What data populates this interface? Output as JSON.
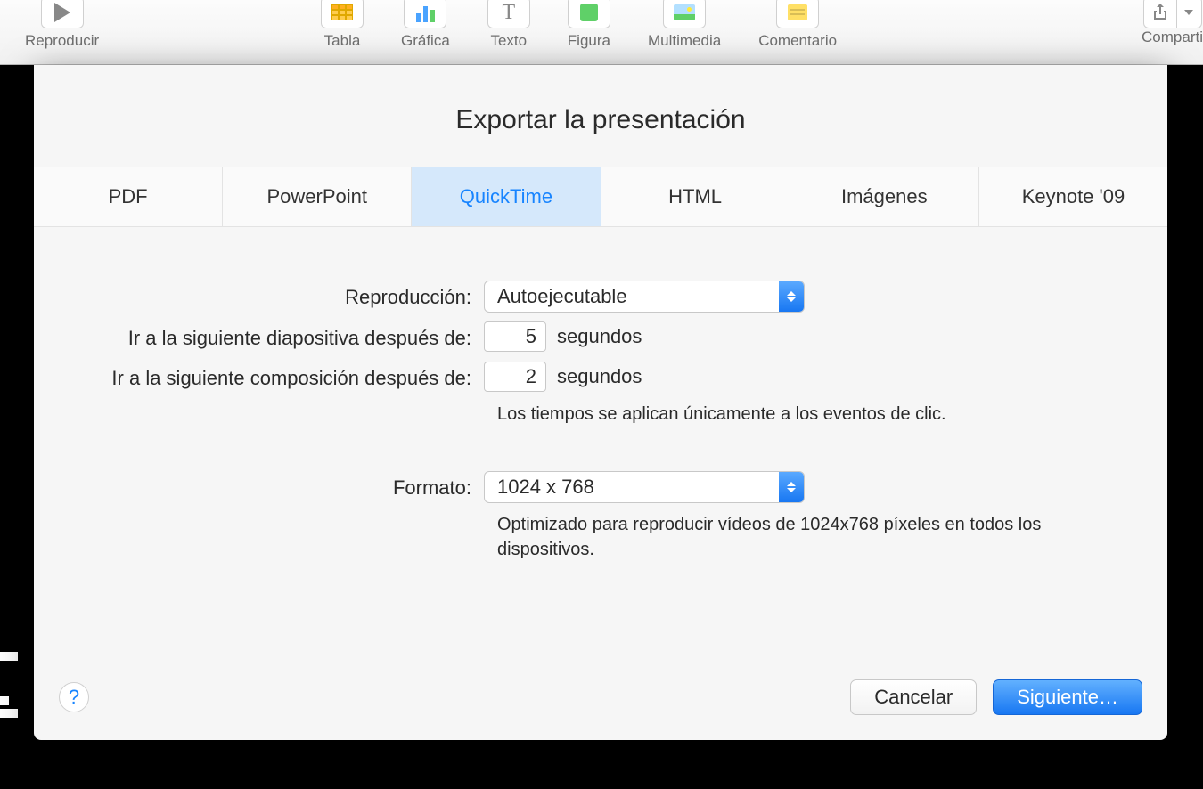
{
  "toolbar": {
    "play_label": "Reproducir",
    "items": [
      {
        "label": "Tabla"
      },
      {
        "label": "Gráfica"
      },
      {
        "label": "Texto"
      },
      {
        "label": "Figura"
      },
      {
        "label": "Multimedia"
      },
      {
        "label": "Comentario"
      }
    ],
    "share_label": "Comparti"
  },
  "dialog": {
    "title": "Exportar la presentación",
    "tabs": [
      {
        "label": "PDF"
      },
      {
        "label": "PowerPoint"
      },
      {
        "label": "QuickTime"
      },
      {
        "label": "HTML"
      },
      {
        "label": "Imágenes"
      },
      {
        "label": "Keynote '09"
      }
    ],
    "playback_label": "Reproducción:",
    "playback_value": "Autoejecutable",
    "next_slide_label": "Ir a la siguiente diapositiva después de:",
    "next_slide_value": "5",
    "next_build_label": "Ir a la siguiente composición después de:",
    "next_build_value": "2",
    "seconds_unit": "segundos",
    "timing_note": "Los tiempos se aplican únicamente a los eventos de clic.",
    "format_label": "Formato:",
    "format_value": "1024 x 768",
    "format_note": "Optimizado para reproducir vídeos de 1024x768 píxeles en todos los dispositivos.",
    "help_symbol": "?",
    "cancel_label": "Cancelar",
    "next_label": "Siguiente…"
  }
}
